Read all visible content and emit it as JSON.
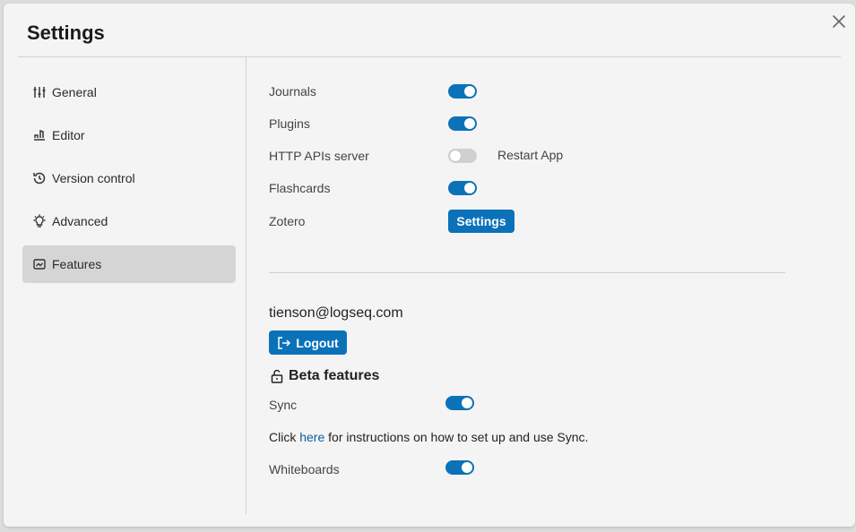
{
  "dialog": {
    "title": "Settings",
    "close_icon": "close-icon"
  },
  "sidebar": {
    "items": [
      {
        "label": "General",
        "icon": "sliders-icon",
        "active": false
      },
      {
        "label": "Editor",
        "icon": "editor-icon",
        "active": false
      },
      {
        "label": "Version control",
        "icon": "history-icon",
        "active": false
      },
      {
        "label": "Advanced",
        "icon": "bulb-icon",
        "active": false
      },
      {
        "label": "Features",
        "icon": "features-icon",
        "active": true
      }
    ]
  },
  "features": {
    "journals": {
      "label": "Journals",
      "enabled": true
    },
    "plugins": {
      "label": "Plugins",
      "enabled": true
    },
    "http_api": {
      "label": "HTTP APIs server",
      "enabled": false,
      "restart_label": "Restart App"
    },
    "flashcards": {
      "label": "Flashcards",
      "enabled": true
    },
    "zotero": {
      "label": "Zotero",
      "button_label": "Settings"
    }
  },
  "account": {
    "email": "tienson@logseq.com",
    "logout_label": "Logout"
  },
  "beta": {
    "heading": "Beta features",
    "sync": {
      "label": "Sync",
      "enabled": true
    },
    "sync_desc": {
      "prefix": "Click ",
      "link": "here",
      "suffix": " for instructions on how to set up and use Sync."
    },
    "whiteboards": {
      "label": "Whiteboards",
      "enabled": true
    }
  },
  "colors": {
    "accent": "#0b72b9",
    "toggle_off": "#d0d0d0",
    "active_nav_bg": "#d5d5d5"
  }
}
